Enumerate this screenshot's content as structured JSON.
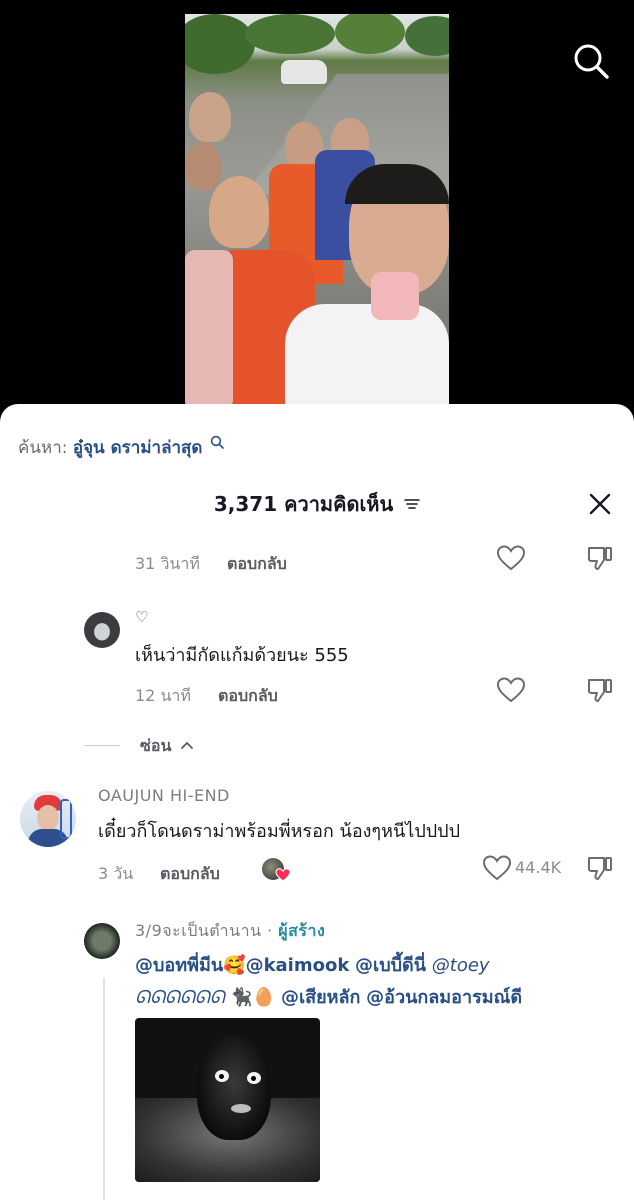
{
  "search": {
    "prefix": "ค้นหา:",
    "query": "อู๋จุน ดราม่าล่าสุด"
  },
  "header": {
    "title": "3,371 ความคิดเห็น"
  },
  "comments": [
    {
      "time": "31 วินาที",
      "reply": "ตอบกลับ"
    },
    {
      "username": "♡",
      "text": "เห็นว่ามีกัดแก้มด้วยนะ 555",
      "time": "12 นาที",
      "reply": "ตอบกลับ"
    },
    {
      "username": "OAUJUN HI-END",
      "text": "เดี๋ยวก็โดนดราม่าพร้อมพี่หรอก น้องๆหนีไปปปป",
      "time": "3 วัน",
      "reply": "ตอบกลับ",
      "likes": "44.4K"
    },
    {
      "username": "3/9จะเป็นตำนาน",
      "separator": " · ",
      "creator_tag": "ผู้สร้าง",
      "line1": {
        "m1": "@บอทพี่มีน",
        "emoji1": "🥰",
        "m2": "@kaimook",
        "m3": "@เบบี้ดีนี่",
        "m4": "@toey"
      },
      "line2": {
        "deco": "ᘏᘏᘏᘏᘏᘏ",
        "emoji2": "🐈‍⬛🥚",
        "m5": "@เสียหลัก",
        "m6": "@อ้วนกลมอารมณ์ดี"
      }
    }
  ],
  "hide_replies": {
    "label": "ซ่อน"
  },
  "colors": {
    "accent": "#2a4f86",
    "creator": "#2b8a9c",
    "liked": "#fe2c55",
    "text": "#161823",
    "muted": "#8a8b91"
  },
  "icons": {
    "search": "search-icon",
    "close": "close-icon",
    "like": "heart-icon",
    "dislike": "dislike-icon",
    "filter": "filter-icon"
  }
}
